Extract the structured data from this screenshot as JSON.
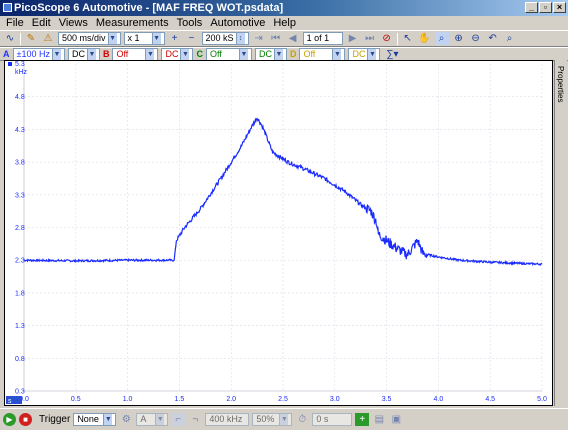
{
  "window": {
    "title": "PicoScope 6 Automotive - [MAF FREQ WOT.psdata]",
    "buttons": [
      "_",
      "▫",
      "×"
    ]
  },
  "menu": [
    "File",
    "Edit",
    "Views",
    "Measurements",
    "Tools",
    "Automotive",
    "Help"
  ],
  "toolbar": {
    "timebase": "500 ms/div",
    "zoom": "x 1",
    "samples": "200 kS",
    "buffer": "1 of 1"
  },
  "channels": {
    "a": {
      "letter": "A",
      "range": "±100 Hz",
      "coupling": "DC",
      "color": "#2233ff"
    },
    "b": {
      "letter": "B",
      "range": "Off",
      "coupling": "DC",
      "color": "#d00000"
    },
    "c": {
      "letter": "C",
      "range": "Off",
      "coupling": "DC",
      "color": "#008000"
    },
    "d": {
      "letter": "D",
      "range": "Off",
      "coupling": "DC",
      "color": "#c8a000"
    }
  },
  "properties_label": "Properties",
  "status": {
    "trigger_label": "Trigger",
    "trigger_mode": "None",
    "trigger_channel": "A",
    "threshold": "400 kHz",
    "pre_trigger": "50%",
    "delay": "0 s"
  },
  "chart_data": {
    "type": "line",
    "title": "",
    "ylabel": "kHz",
    "xlabel": "",
    "x_unit": "s",
    "xlim": [
      0,
      5
    ],
    "ylim": [
      0.3,
      5.3
    ],
    "x_ticks": [
      "0.0",
      "0.5",
      "1.0",
      "1.5",
      "2.0",
      "2.5",
      "3.0",
      "3.5",
      "4.0",
      "4.5",
      "5.0"
    ],
    "y_ticks": [
      "0.3",
      "0.8",
      "1.3",
      "1.8",
      "2.3",
      "2.8",
      "3.3",
      "3.8",
      "4.3",
      "4.8"
    ],
    "y_top_label": "5.3",
    "axis_badge": "s",
    "grid": true,
    "series": [
      {
        "color": "#1a2bff",
        "x": [
          0.0,
          0.5,
          1.0,
          1.45,
          1.47,
          1.55,
          1.7,
          1.9,
          2.0,
          2.1,
          2.2,
          2.25,
          2.3,
          2.4,
          2.55,
          2.7,
          2.9,
          3.1,
          3.25,
          3.35,
          3.4,
          3.42,
          3.5,
          3.6,
          3.7,
          3.8,
          3.85,
          4.0,
          4.2,
          4.5,
          4.8,
          5.0
        ],
        "y": [
          2.3,
          2.29,
          2.3,
          2.3,
          2.6,
          2.8,
          3.08,
          3.55,
          3.8,
          4.05,
          4.35,
          4.48,
          4.35,
          3.95,
          3.8,
          3.7,
          3.55,
          3.35,
          3.15,
          3.05,
          2.9,
          2.7,
          2.6,
          2.48,
          2.38,
          2.6,
          2.4,
          2.35,
          2.3,
          2.27,
          2.25,
          2.24
        ]
      }
    ]
  }
}
